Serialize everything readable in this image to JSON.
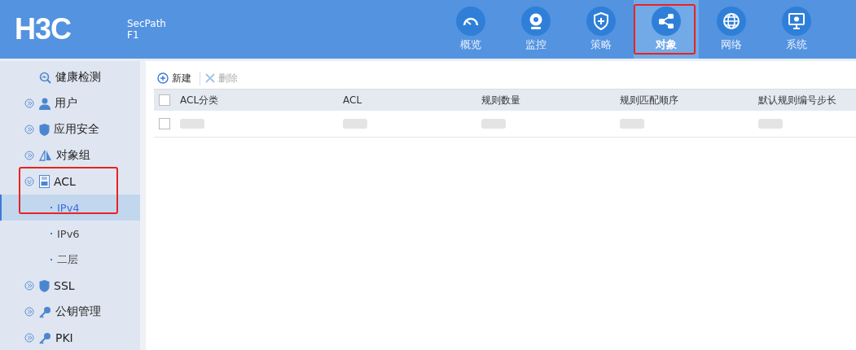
{
  "header": {
    "logo": "H3C",
    "product": "SecPath",
    "model": "F1"
  },
  "nav": [
    {
      "label": "概览",
      "selected": false,
      "annotated": false
    },
    {
      "label": "监控",
      "selected": false,
      "annotated": false
    },
    {
      "label": "策略",
      "selected": false,
      "annotated": false
    },
    {
      "label": "对象",
      "selected": true,
      "annotated": true
    },
    {
      "label": "网络",
      "selected": false,
      "annotated": false
    },
    {
      "label": "系统",
      "selected": false,
      "annotated": false
    }
  ],
  "sidebar": {
    "items": [
      {
        "label": "健康检测",
        "kind": "leaf"
      },
      {
        "label": "用户",
        "kind": "group",
        "expanded": false,
        "annotated": false
      },
      {
        "label": "应用安全",
        "kind": "group",
        "expanded": false,
        "annotated": false
      },
      {
        "label": "对象组",
        "kind": "group",
        "expanded": false,
        "annotated": false
      },
      {
        "label": "ACL",
        "kind": "group",
        "expanded": true,
        "annotated": true,
        "children": [
          {
            "label": "IPv4",
            "selected": true
          },
          {
            "label": "IPv6",
            "selected": false
          },
          {
            "label": "二层",
            "selected": false
          }
        ]
      },
      {
        "label": "SSL",
        "kind": "group",
        "expanded": false,
        "annotated": false
      },
      {
        "label": "公钥管理",
        "kind": "group",
        "expanded": false,
        "annotated": false
      },
      {
        "label": "PKI",
        "kind": "group",
        "expanded": false,
        "annotated": false
      }
    ]
  },
  "toolbar": [
    {
      "label": "新建",
      "disabled": false
    },
    {
      "label": "删除",
      "disabled": true
    }
  ],
  "table": {
    "header_checked": false,
    "columns": [
      "ACL分类",
      "ACL",
      "规则数量",
      "规则匹配顺序",
      "默认规则编号步长"
    ],
    "rows": [
      {
        "checked": false
      }
    ]
  }
}
